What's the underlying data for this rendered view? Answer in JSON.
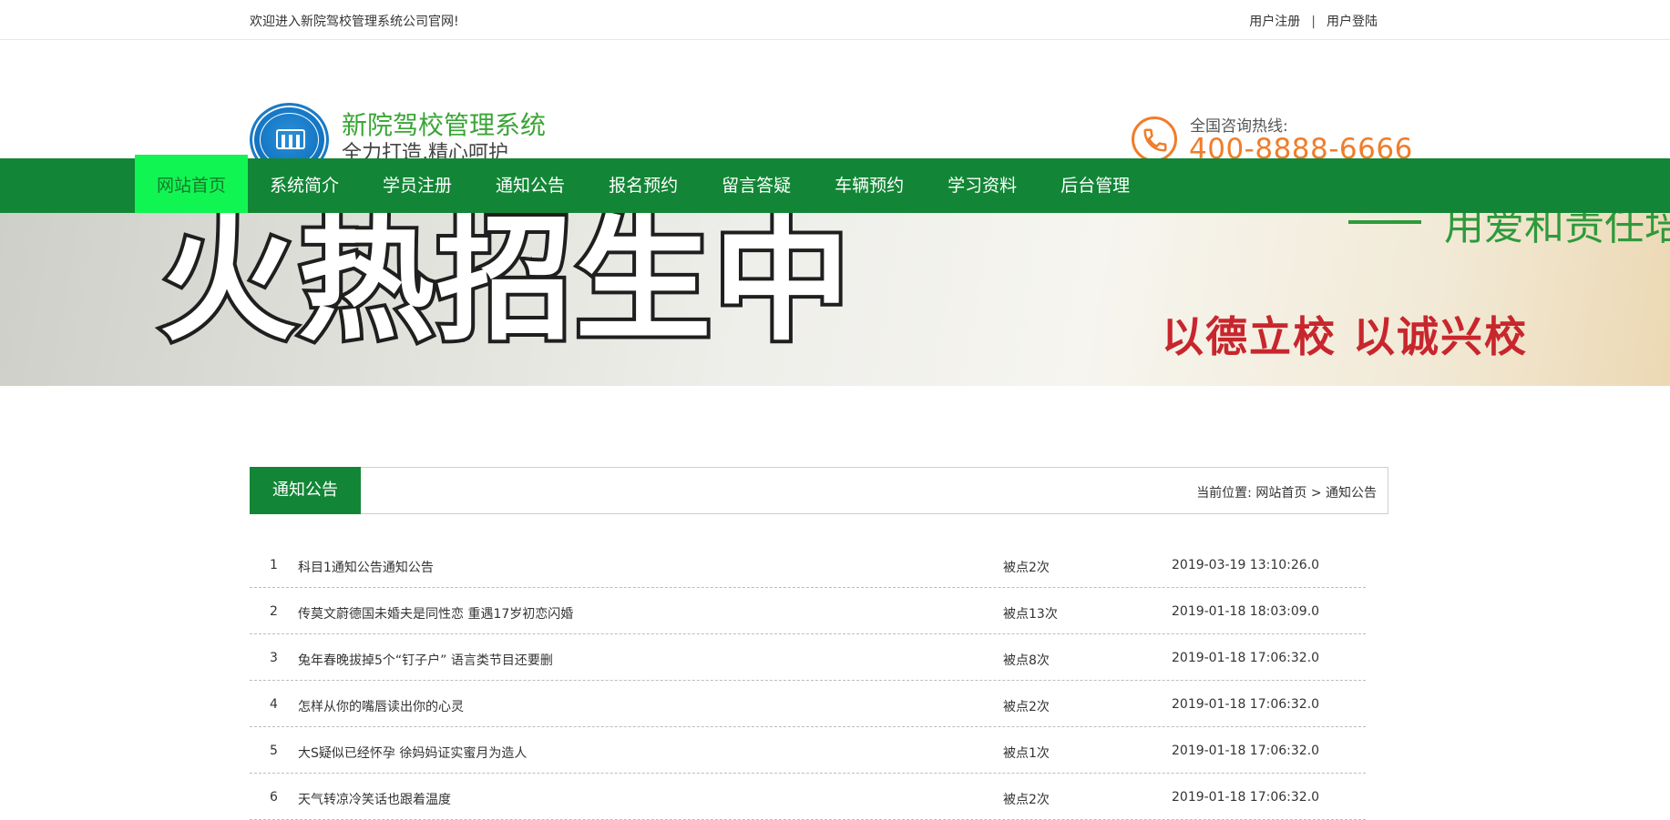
{
  "topbar": {
    "welcome": "欢迎进入新院驾校管理系统公司官网!",
    "register": "用户注册",
    "separator": "|",
    "login": "用户登陆"
  },
  "header": {
    "title": "新院驾校管理系统",
    "slogan": "全力打造,精心呵护",
    "hotline_label": "全国咨询热线:",
    "hotline_number": "400-8888-6666"
  },
  "nav": {
    "items": [
      {
        "label": "网站首页",
        "active": true
      },
      {
        "label": "系统简介"
      },
      {
        "label": "学员注册"
      },
      {
        "label": "通知公告"
      },
      {
        "label": "报名预约"
      },
      {
        "label": "留言答疑"
      },
      {
        "label": "车辆预约"
      },
      {
        "label": "学习资料"
      },
      {
        "label": "后台管理"
      }
    ]
  },
  "banner": {
    "headline": "火热招生中",
    "tagline": "以德立校 以诚兴校",
    "top_text": "用爱和责任培"
  },
  "section": {
    "tab": "通知公告",
    "crumb_prefix": "当前位置:",
    "crumb_home": "网站首页",
    "crumb_sep": ">",
    "crumb_current": "通知公告"
  },
  "notices": [
    {
      "idx": "1",
      "title": "科目1通知公告通知公告",
      "views": "被点2次",
      "date": "2019-03-19 13:10:26.0"
    },
    {
      "idx": "2",
      "title": "传莫文蔚德国未婚夫是同性恋 重遇17岁初恋闪婚",
      "views": "被点13次",
      "date": "2019-01-18 18:03:09.0"
    },
    {
      "idx": "3",
      "title": "兔年春晚拔掉5个“钉子户” 语言类节目还要删",
      "views": "被点8次",
      "date": "2019-01-18 17:06:32.0"
    },
    {
      "idx": "4",
      "title": "怎样从你的嘴唇读出你的心灵",
      "views": "被点2次",
      "date": "2019-01-18 17:06:32.0"
    },
    {
      "idx": "5",
      "title": "大S疑似已经怀孕 徐妈妈证实蜜月为造人",
      "views": "被点1次",
      "date": "2019-01-18 17:06:32.0"
    },
    {
      "idx": "6",
      "title": "天气转凉冷笑话也跟着温度",
      "views": "被点2次",
      "date": "2019-01-18 17:06:32.0"
    }
  ],
  "colors": {
    "brand_green": "#128636",
    "active_nav": "#11f552",
    "hotline_orange": "#f07d2a"
  }
}
